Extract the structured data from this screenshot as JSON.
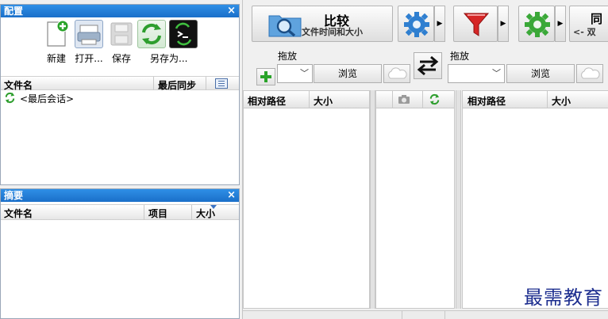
{
  "config_panel": {
    "title": "配置",
    "close": "×",
    "toolbar": {
      "new_label": "新建",
      "open_label": "打开...",
      "save_label": "保存",
      "saveas_label": "另存为..."
    },
    "columns": {
      "name": "文件名",
      "last_sync": "最后同步"
    },
    "sessions": [
      {
        "label": "<最后会话>"
      }
    ]
  },
  "summary_panel": {
    "title": "摘要",
    "close": "×",
    "columns": {
      "name": "文件名",
      "items": "项目",
      "size": "大小"
    }
  },
  "main_toolbar": {
    "compare_title": "比较",
    "compare_sub": "文件时间和大小",
    "sync_title": "同",
    "sync_sub": "<- 双"
  },
  "left_side": {
    "drag_label": "拖放",
    "browse_label": "浏览"
  },
  "right_side": {
    "drag_label": "拖放",
    "browse_label": "浏览"
  },
  "grid_left": {
    "col_path": "相对路径",
    "col_size": "大小"
  },
  "grid_right": {
    "col_path": "相对路径",
    "col_size": "大小"
  },
  "watermark": "最需教育",
  "colors": {
    "panel_title": "#1a6fc9",
    "compare_icon": "#1f7fcf",
    "filter_icon": "#d62626",
    "sync_icon": "#3aa838"
  }
}
